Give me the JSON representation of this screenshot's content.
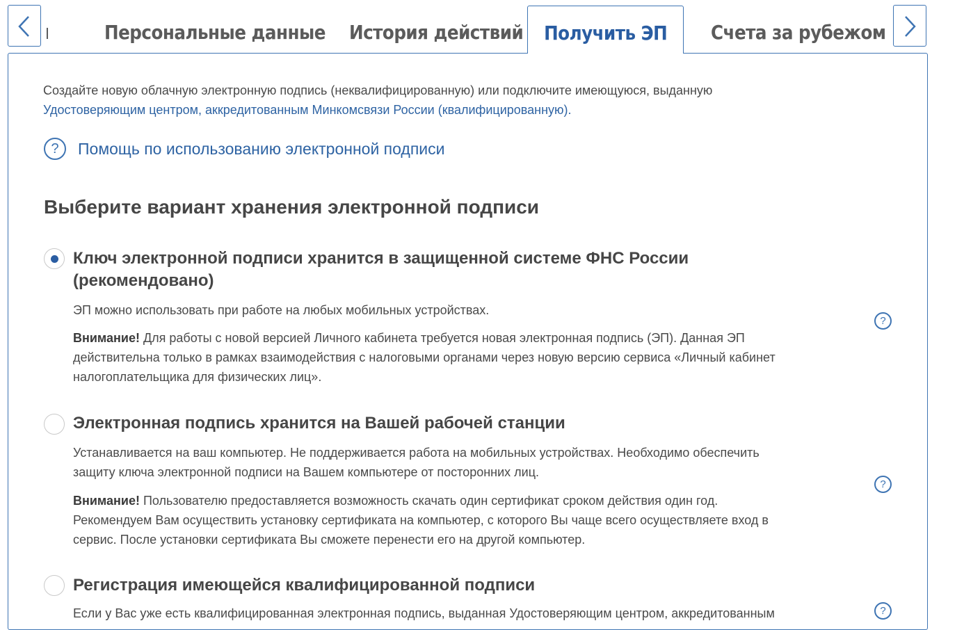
{
  "tabs": {
    "items": [
      {
        "label": "Персональные данные"
      },
      {
        "label": "История действий"
      },
      {
        "label": "Получить ЭП"
      },
      {
        "label": "Счета за рубежом"
      }
    ],
    "active_index": 2
  },
  "intro": {
    "text": "Создайте новую облачную электронную подпись (неквалифицированную) или подключите имеющуюся, выданную",
    "link": "Удостоверяющим центром, аккредитованным Минкомсвязи России (квалифицированную).",
    "help_link": "Помощь по использованию электронной подписи",
    "help_icon": "?"
  },
  "section_title": "Выберите вариант хранения электронной подписи",
  "options": [
    {
      "title_line1": "Ключ электронной подписи хранится в защищенной системе ФНС России",
      "title_line2": "(рекомендовано)",
      "text": "ЭП можно использовать при работе на любых мобильных устройствах.",
      "warning_label": "Внимание!",
      "warning_line1": " Для работы с новой версией Личного кабинета требуется новая электронная подпись (ЭП). Данная ЭП",
      "warning_line2": "действительна только в рамках взаимодействия с налоговыми органами через новую версию сервиса  «Личный кабинет",
      "warning_line3": "налогоплательщика для физических лиц».",
      "selected": true
    },
    {
      "title_line1": "Электронная подпись хранится на Вашей рабочей станции",
      "text_line1": "Устанавливается на ваш компьютер. Не поддерживается работа на мобильных устройствах. Необходимо обеспечить",
      "text_line2": "защиту ключа электронной подписи на Вашем компьютере от посторонних лиц.",
      "warning_label": "Внимание!",
      "warning_line1": " Пользователю предоставляется возможность скачать один сертификат  сроком действия один год.",
      "warning_line2": "Рекомендуем Вам осуществить установку сертификата на компьютер, с которого Вы  чаще всего осуществляете вход в",
      "warning_line3": "сервис. После установки сертификата Вы сможете перенести его на другой  компьютер.",
      "selected": false
    },
    {
      "title_line1": "Регистрация имеющейся квалифицированной подписи",
      "text_cut": "Если у Вас уже есть квалифицированная электронная подпись, выданная Удостоверяющим центром, аккредитованным",
      "selected": false
    }
  ],
  "icons": {
    "prev": "chevron-left-icon",
    "next": "chevron-right-icon",
    "help": "question-circle-icon"
  },
  "colors": {
    "accent": "#3e74b3",
    "link": "#2e63a3",
    "active_tab": "#2a5da2",
    "text": "#4a4a4a"
  }
}
